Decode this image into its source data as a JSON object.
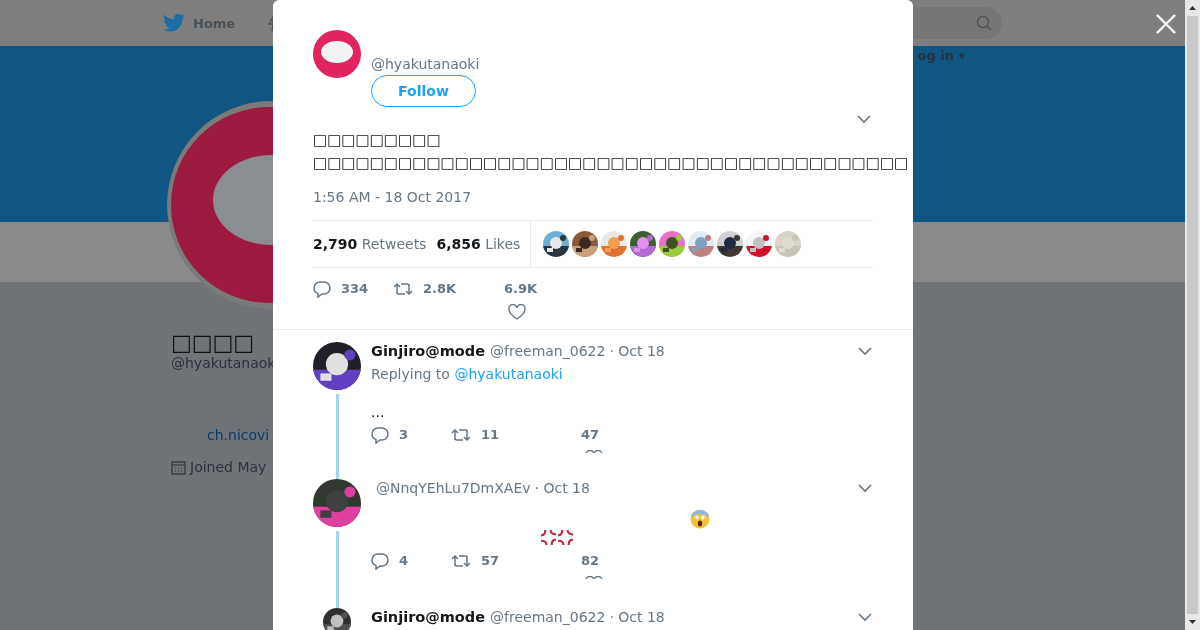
{
  "background": {
    "nav": {
      "home": "Home"
    },
    "search": {
      "kind": "field"
    },
    "login": "og in ▾",
    "profile": {
      "name": "□□□□",
      "handle": "@hyakutanaok",
      "link": "ch.nicovi",
      "joined": "Joined May"
    }
  },
  "tweet": {
    "handle": "@hyakutanaoki",
    "follow": "Follow",
    "text_lines": [
      "□□□□□□□□□",
      "□□□□□□□□□□□□□□□□□□□□□□□□□□□□□□□□□□□□□□□□□□"
    ],
    "time": "1:56 AM - 18 Oct 2017",
    "stats": [
      {
        "count": "2,790",
        "label": "Retweets"
      },
      {
        "count": "6,856",
        "label": "Likes"
      }
    ],
    "actions": {
      "replies": "334",
      "retweets": "2.8K",
      "likes": "6.9K"
    }
  },
  "replies": [
    {
      "name": "Ginjiro@mode",
      "handle": "@freeman_0622",
      "date": "· Oct 18",
      "replying_label": "Replying to",
      "replying_handle": "@hyakutanaoki",
      "text": "...",
      "kind": "text",
      "actions": {
        "replies": "3",
        "retweets": "11",
        "likes": "47"
      }
    },
    {
      "handle": "@NnqYEhLu7DmXAEv",
      "date": "· Oct 18",
      "kind": "emoji",
      "actions": {
        "replies": "4",
        "retweets": "57",
        "likes": "82"
      }
    },
    {
      "name": "Ginjiro@mode",
      "handle": "@freeman_0622",
      "date": "· Oct 18",
      "kind": "header"
    }
  ]
}
